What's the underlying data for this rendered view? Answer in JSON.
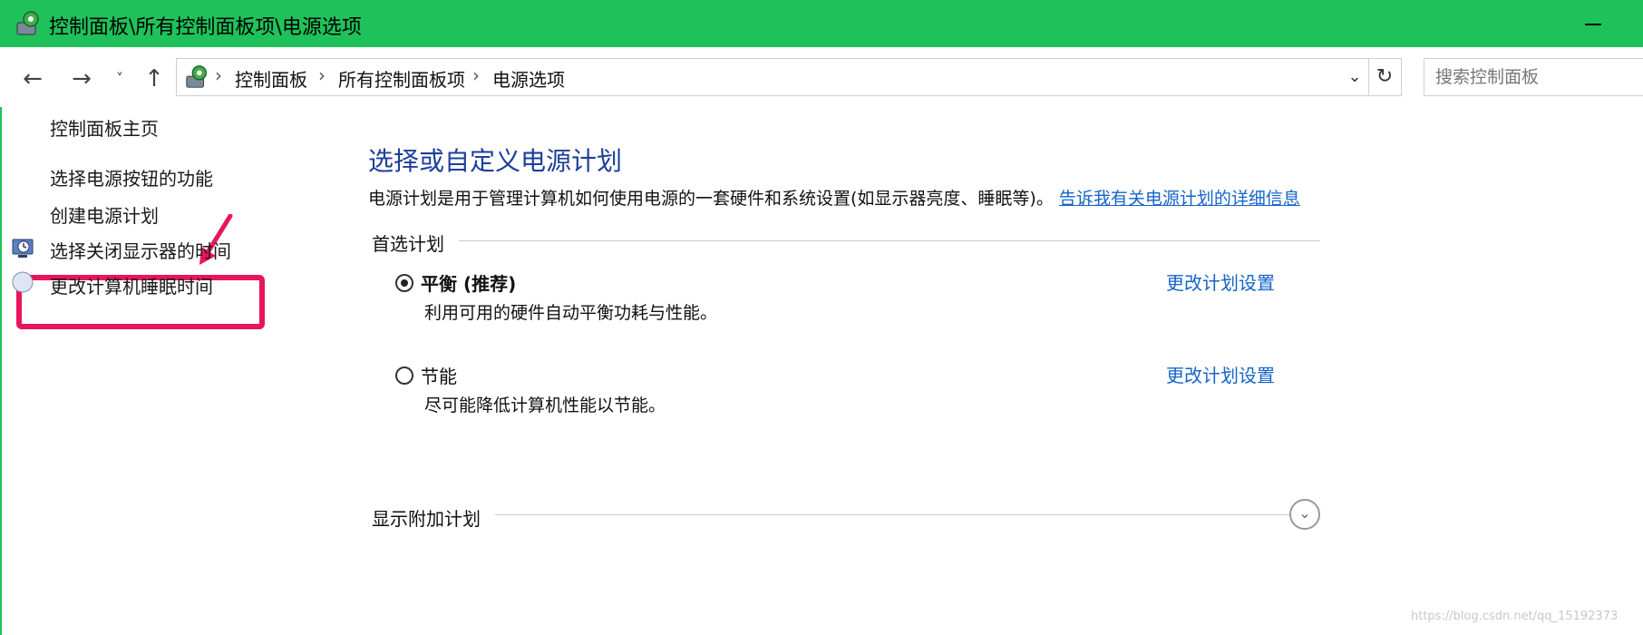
{
  "window": {
    "title": "控制面板\\所有控制面板项\\电源选项",
    "icon": "control-panel-icon",
    "accent_color": "#1fc25a"
  },
  "nav": {
    "back_icon": "←",
    "forward_icon": "→",
    "recent_icon": "˅",
    "up_icon": "↑",
    "breadcrumbs": [
      "控制面板",
      "所有控制面板项",
      "电源选项"
    ],
    "separator": "›",
    "dropdown_icon": "⌄",
    "refresh_icon": "↻",
    "search_placeholder": "搜索控制面板"
  },
  "sidebar": {
    "home": "控制面板主页",
    "items": [
      {
        "label": "选择电源按钮的功能",
        "highlighted": true
      },
      {
        "label": "创建电源计划"
      },
      {
        "label": "选择关闭显示器的时间",
        "icon": "monitor-clock-icon"
      },
      {
        "label": "更改计算机睡眠时间",
        "icon": "moon-icon"
      }
    ],
    "highlight_color": "#e8155a"
  },
  "main": {
    "title": "选择或自定义电源计划",
    "description_text": "电源计划是用于管理计算机如何使用电源的一套硬件和系统设置(如显示器亮度、睡眠等)。",
    "description_link": "告诉我有关电源计划的详细信息",
    "preferred_section": "首选计划",
    "plans": [
      {
        "name": "平衡 (推荐)",
        "description": "利用可用的硬件自动平衡功耗与性能。",
        "link": "更改计划设置",
        "selected": true
      },
      {
        "name": "节能",
        "description": "尽可能降低计算机性能以节能。",
        "link": "更改计划设置",
        "selected": false
      }
    ],
    "additional_section": "显示附加计划",
    "expand_icon": "⌄",
    "link_color": "#1565c9",
    "title_color": "#1d3f9a"
  },
  "watermark": "https://blog.csdn.net/qq_15192373"
}
